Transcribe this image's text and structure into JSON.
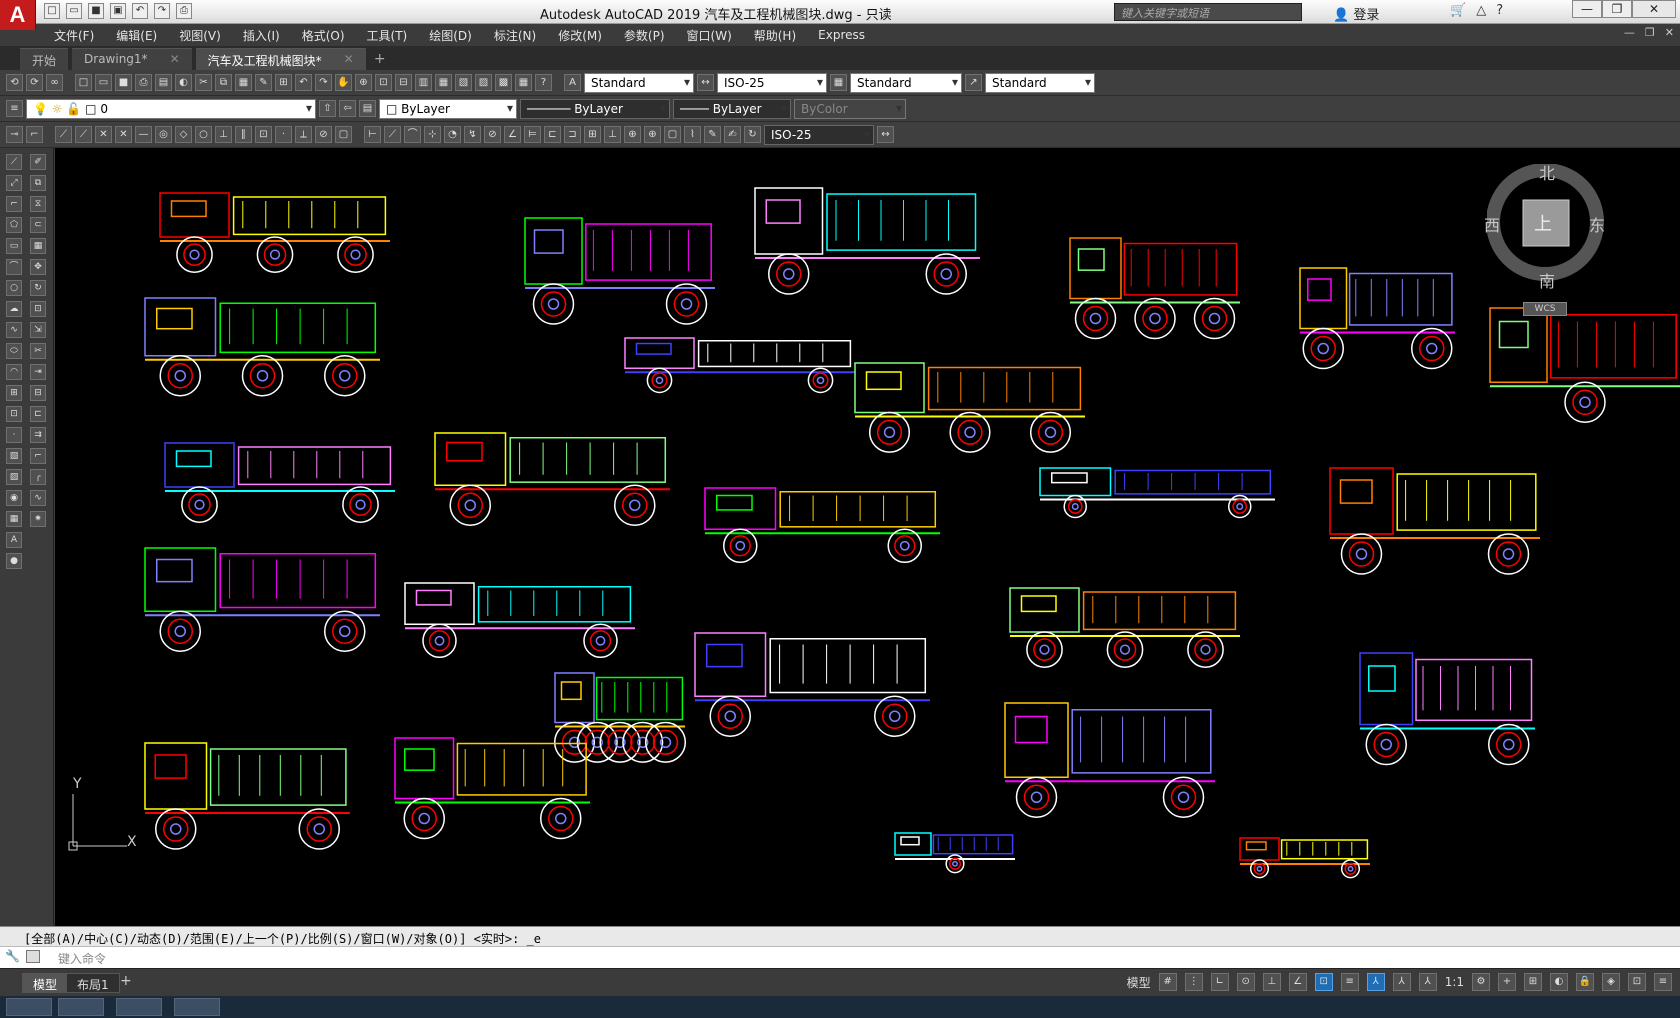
{
  "app": {
    "logo_letter": "A",
    "title": "Autodesk AutoCAD 2019     汽车及工程机械图块.dwg - 只读",
    "search_placeholder": "键入关键字或短语",
    "login": "登录"
  },
  "window_buttons": {
    "minimize": "—",
    "restore": "❐",
    "close": "✕"
  },
  "menu": [
    "文件(F)",
    "编辑(E)",
    "视图(V)",
    "插入(I)",
    "格式(O)",
    "工具(T)",
    "绘图(D)",
    "标注(N)",
    "修改(M)",
    "参数(P)",
    "窗口(W)",
    "帮助(H)",
    "Express"
  ],
  "tabs": [
    {
      "label": "开始",
      "active": false
    },
    {
      "label": "Drawing1*",
      "active": false
    },
    {
      "label": "汽车及工程机械图块*",
      "active": true
    }
  ],
  "toolbar1": {
    "text_style": "Standard",
    "dim_style": "ISO-25",
    "table_style": "Standard",
    "mleader_style": "Standard"
  },
  "toolbar2": {
    "layer": "0",
    "color": "ByLayer",
    "linetype": "ByLayer",
    "lineweight": "ByLayer",
    "plot_style": "ByColor"
  },
  "toolbar3": {
    "dim_style": "ISO-25"
  },
  "viewcube": {
    "north": "北",
    "south": "南",
    "east": "东",
    "west": "西",
    "face": "上",
    "wcs": "WCS"
  },
  "ucs": {
    "x": "X",
    "y": "Y"
  },
  "command": {
    "history": "[全部(A)/中心(C)/动态(D)/范围(E)/上一个(P)/比例(S)/窗口(W)/对象(O)] <实时>: _e",
    "placeholder": "键入命令"
  },
  "layout_tabs": [
    {
      "label": "模型",
      "active": true
    },
    {
      "label": "布局1",
      "active": false
    }
  ],
  "status": {
    "model_label": "模型",
    "scale": "1:1"
  },
  "colors": {
    "drawing_bg": "#000000",
    "ui_dark": "#3b3b3b",
    "accent": "#c41c1c"
  }
}
